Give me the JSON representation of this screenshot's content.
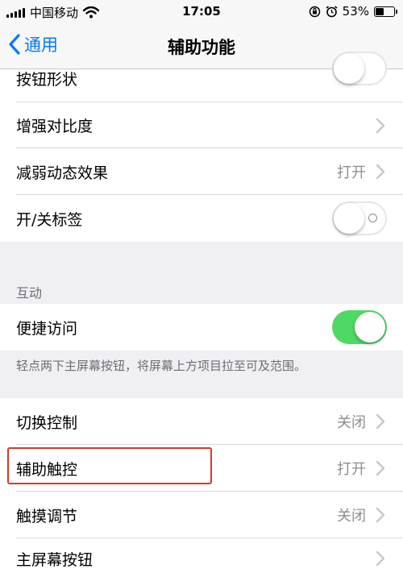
{
  "status_bar": {
    "carrier": "中国移动",
    "time": "17:05",
    "battery_percent": "53%",
    "battery_level": 0.53
  },
  "nav": {
    "back_label": "通用",
    "title": "辅助功能"
  },
  "rows": {
    "button_shapes": {
      "label": "按钮形状",
      "toggle_on": false
    },
    "increase_contrast": {
      "label": "增强对比度"
    },
    "reduce_motion": {
      "label": "减弱动态效果",
      "value": "打开"
    },
    "on_off_labels": {
      "label": "开/关标签",
      "toggle_on": false
    },
    "reachability": {
      "label": "便捷访问",
      "toggle_on": true
    },
    "switch_control": {
      "label": "切换控制",
      "value": "关闭"
    },
    "assistive_touch": {
      "label": "辅助触控",
      "value": "打开"
    },
    "touch_accommodations": {
      "label": "触摸调节",
      "value": "关闭"
    },
    "home_button": {
      "label": "主屏幕按钮"
    }
  },
  "sections": {
    "interaction_header": "互动",
    "reachability_footer": "轻点两下主屏幕按钮，将屏幕上方项目拉至可及范围。"
  },
  "colors": {
    "accent": "#007aff",
    "toggle_on": "#4cd964",
    "highlight": "#d9362b"
  }
}
